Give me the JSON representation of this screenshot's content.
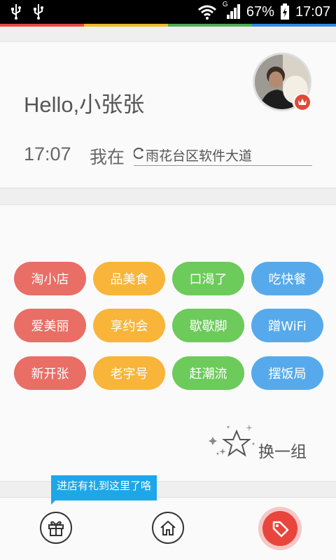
{
  "status_bar": {
    "battery": "67%",
    "time": "17:07",
    "network": "G",
    "icons": [
      "usb-icon",
      "usb-icon",
      "wifi-icon",
      "signal-icon",
      "battery-charging-icon"
    ]
  },
  "color_strip": [
    "#e54b3d",
    "#f3b72c",
    "#4caf50",
    "#2f8ae0"
  ],
  "header": {
    "greeting": "Hello,小张张",
    "time": "17:07",
    "i_am_at": "我在",
    "location": "雨花台区软件大道",
    "avatar_badge_icon": "crown-icon"
  },
  "tags": [
    {
      "label": "淘小店",
      "color": "red"
    },
    {
      "label": "品美食",
      "color": "orange"
    },
    {
      "label": "口渴了",
      "color": "green"
    },
    {
      "label": "吃快餐",
      "color": "blue"
    },
    {
      "label": "爱美丽",
      "color": "red"
    },
    {
      "label": "享约会",
      "color": "orange"
    },
    {
      "label": "歇歇脚",
      "color": "green"
    },
    {
      "label": "蹭WiFi",
      "color": "blue"
    },
    {
      "label": "新开张",
      "color": "red"
    },
    {
      "label": "老字号",
      "color": "orange"
    },
    {
      "label": "赶潮流",
      "color": "green"
    },
    {
      "label": "摆饭局",
      "color": "blue"
    }
  ],
  "refresh_label": "换一组",
  "bottom": {
    "tip": "进店有礼到这里了咯",
    "icons": [
      "gift-icon",
      "home-icon",
      "tag-icon"
    ]
  }
}
